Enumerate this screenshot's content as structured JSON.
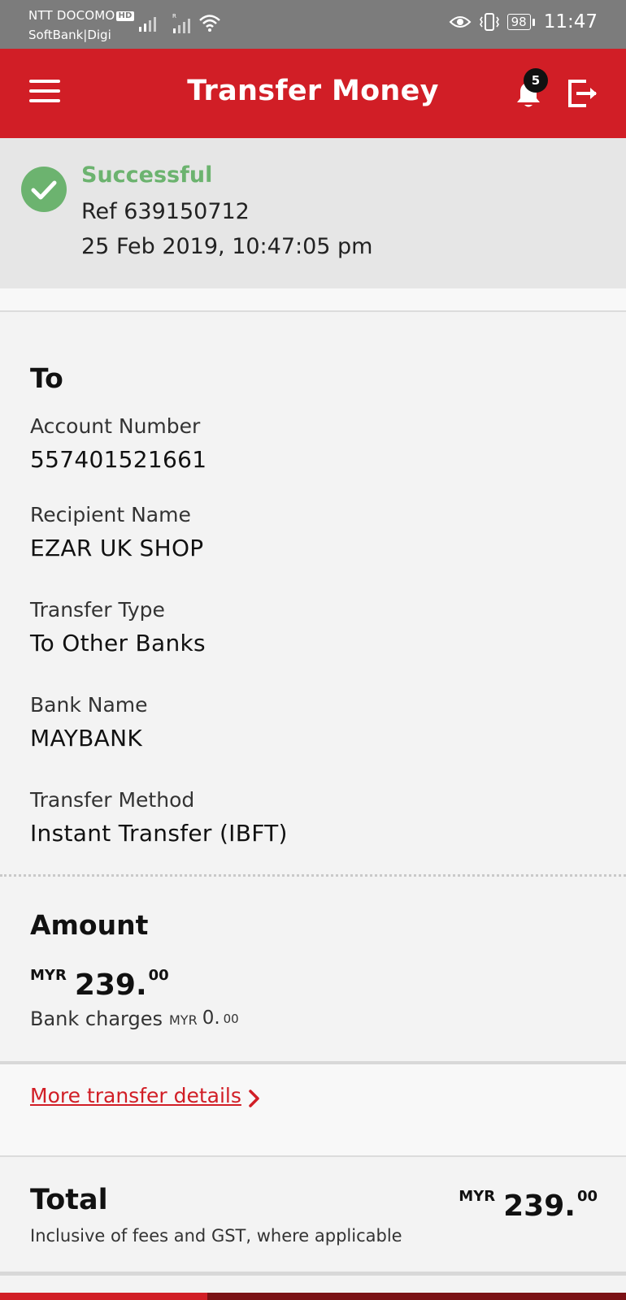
{
  "status_bar": {
    "carrier_primary": "NTT DOCOMO",
    "hd_badge": "HD",
    "carrier_secondary": "SoftBank|Digi",
    "battery": "98",
    "time": "11:47"
  },
  "header": {
    "title": "Transfer Money",
    "notification_count": "5",
    "brand_color": "#d11e26"
  },
  "result": {
    "status": "Successful",
    "reference": "Ref 639150712",
    "datetime": "25 Feb 2019, 10:47:05 pm",
    "status_color": "#6cb36f"
  },
  "recipient": {
    "heading": "To",
    "fields": [
      {
        "label": "Account Number",
        "value": "557401521661"
      },
      {
        "label": "Recipient Name",
        "value": "EZAR UK SHOP"
      },
      {
        "label": "Transfer Type",
        "value": "To Other Banks"
      },
      {
        "label": "Bank Name",
        "value": "MAYBANK"
      },
      {
        "label": "Transfer Method",
        "value": "Instant Transfer (IBFT)"
      }
    ]
  },
  "amount": {
    "heading": "Amount",
    "currency": "MYR",
    "whole": "239.",
    "cents": "00",
    "charges_label": "Bank charges",
    "charges_currency": "MYR",
    "charges_whole": "0.",
    "charges_cents": "00"
  },
  "more_details": {
    "link_label": "More transfer details"
  },
  "total": {
    "label": "Total",
    "note": "Inclusive of fees and GST, where applicable",
    "currency": "MYR",
    "whole": "239.",
    "cents": "00"
  }
}
